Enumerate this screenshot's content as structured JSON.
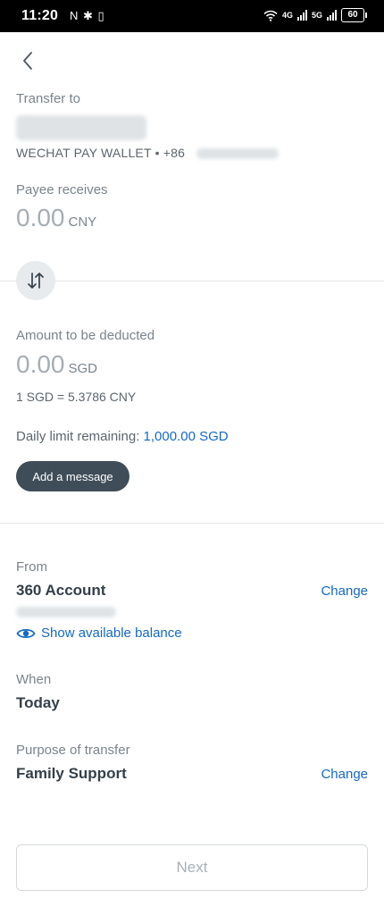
{
  "status_bar": {
    "time": "11:20",
    "left_icons": "N ✱ ▯",
    "network_1": "4G",
    "network_2": "5G",
    "battery": "60"
  },
  "transfer": {
    "title": "Transfer to",
    "recipient_subtitle": "WECHAT PAY WALLET • +86"
  },
  "payee": {
    "label": "Payee receives",
    "amount": "0.00",
    "currency": "CNY"
  },
  "deduct": {
    "label": "Amount to be deducted",
    "amount": "0.00",
    "currency": "SGD",
    "rate": "1 SGD = 5.3786 CNY"
  },
  "limit": {
    "label": "Daily limit remaining:",
    "value": "1,000.00 SGD"
  },
  "message_button": "Add a message",
  "from": {
    "label": "From",
    "account": "360 Account",
    "change": "Change",
    "show_balance": "Show available balance"
  },
  "when": {
    "label": "When",
    "value": "Today"
  },
  "purpose": {
    "label": "Purpose of transfer",
    "value": "Family Support",
    "change": "Change"
  },
  "next_button": "Next",
  "colors": {
    "accent": "#1469c7",
    "button_dark": "#3f4d58",
    "muted_amount": "#a6aeb4"
  }
}
